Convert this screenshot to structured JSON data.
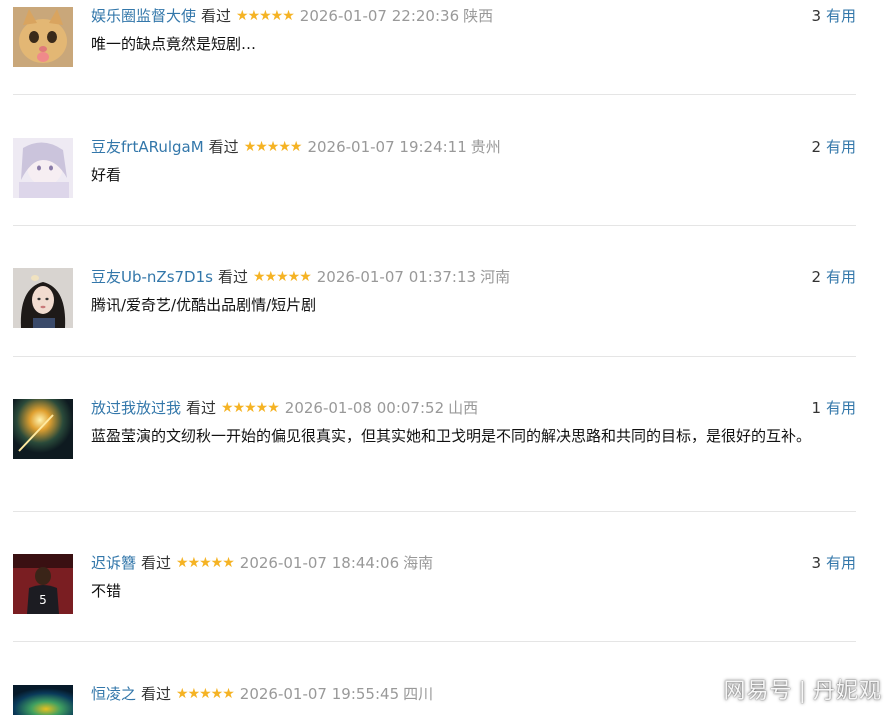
{
  "comments": [
    {
      "user": "娱乐圈监督大使",
      "status": "看过",
      "stars": "★★★★★",
      "time": "2026-01-07 22:20:36",
      "location": "陕西",
      "votes": "3",
      "vote_label": "有用",
      "content": "唯一的缺点竟然是短剧…"
    },
    {
      "user": "豆友frtARulgaM",
      "status": "看过",
      "stars": "★★★★★",
      "time": "2026-01-07 19:24:11",
      "location": "贵州",
      "votes": "2",
      "vote_label": "有用",
      "content": "好看"
    },
    {
      "user": "豆友Ub-nZs7D1s",
      "status": "看过",
      "stars": "★★★★★",
      "time": "2026-01-07 01:37:13",
      "location": "河南",
      "votes": "2",
      "vote_label": "有用",
      "content": "腾讯/爱奇艺/优酷出品剧情/短片剧"
    },
    {
      "user": "放过我放过我",
      "status": "看过",
      "stars": "★★★★★",
      "time": "2026-01-08 00:07:52",
      "location": "山西",
      "votes": "1",
      "vote_label": "有用",
      "content": "蓝盈莹演的文纫秋一开始的偏见很真实，但其实她和卫戈明是不同的解决思路和共同的目标，是很好的互补。"
    },
    {
      "user": "迟诉簪",
      "status": "看过",
      "stars": "★★★★★",
      "time": "2026-01-07 18:44:06",
      "location": "海南",
      "votes": "3",
      "vote_label": "有用",
      "content": "不错"
    },
    {
      "user": "恒凌之",
      "status": "看过",
      "stars": "★★★★★",
      "time": "2026-01-07 19:55:45",
      "location": "四川",
      "votes": "",
      "vote_label": "",
      "content": ""
    }
  ],
  "watermark": {
    "source": "网易号",
    "author": "丹妮观"
  },
  "colors": {
    "link": "#3377aa",
    "star": "#f5b324",
    "meta": "#999999",
    "divider": "#e5e5e5"
  }
}
